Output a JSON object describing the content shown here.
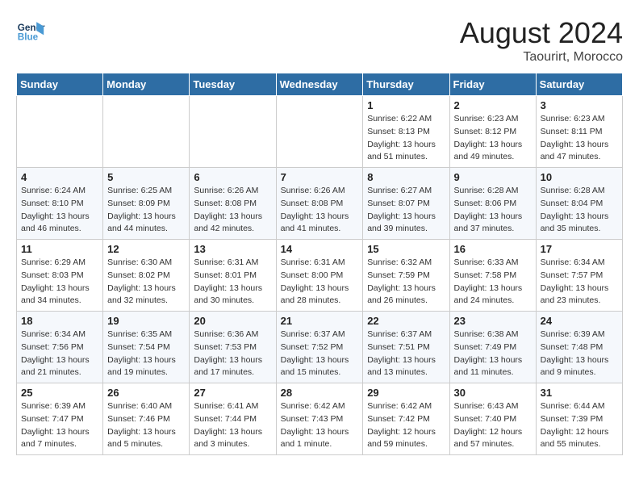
{
  "header": {
    "logo_line1": "General",
    "logo_line2": "Blue",
    "month_title": "August 2024",
    "location": "Taourirt, Morocco"
  },
  "weekdays": [
    "Sunday",
    "Monday",
    "Tuesday",
    "Wednesday",
    "Thursday",
    "Friday",
    "Saturday"
  ],
  "weeks": [
    [
      {
        "day": "",
        "info": ""
      },
      {
        "day": "",
        "info": ""
      },
      {
        "day": "",
        "info": ""
      },
      {
        "day": "",
        "info": ""
      },
      {
        "day": "1",
        "info": "Sunrise: 6:22 AM\nSunset: 8:13 PM\nDaylight: 13 hours\nand 51 minutes."
      },
      {
        "day": "2",
        "info": "Sunrise: 6:23 AM\nSunset: 8:12 PM\nDaylight: 13 hours\nand 49 minutes."
      },
      {
        "day": "3",
        "info": "Sunrise: 6:23 AM\nSunset: 8:11 PM\nDaylight: 13 hours\nand 47 minutes."
      }
    ],
    [
      {
        "day": "4",
        "info": "Sunrise: 6:24 AM\nSunset: 8:10 PM\nDaylight: 13 hours\nand 46 minutes."
      },
      {
        "day": "5",
        "info": "Sunrise: 6:25 AM\nSunset: 8:09 PM\nDaylight: 13 hours\nand 44 minutes."
      },
      {
        "day": "6",
        "info": "Sunrise: 6:26 AM\nSunset: 8:08 PM\nDaylight: 13 hours\nand 42 minutes."
      },
      {
        "day": "7",
        "info": "Sunrise: 6:26 AM\nSunset: 8:08 PM\nDaylight: 13 hours\nand 41 minutes."
      },
      {
        "day": "8",
        "info": "Sunrise: 6:27 AM\nSunset: 8:07 PM\nDaylight: 13 hours\nand 39 minutes."
      },
      {
        "day": "9",
        "info": "Sunrise: 6:28 AM\nSunset: 8:06 PM\nDaylight: 13 hours\nand 37 minutes."
      },
      {
        "day": "10",
        "info": "Sunrise: 6:28 AM\nSunset: 8:04 PM\nDaylight: 13 hours\nand 35 minutes."
      }
    ],
    [
      {
        "day": "11",
        "info": "Sunrise: 6:29 AM\nSunset: 8:03 PM\nDaylight: 13 hours\nand 34 minutes."
      },
      {
        "day": "12",
        "info": "Sunrise: 6:30 AM\nSunset: 8:02 PM\nDaylight: 13 hours\nand 32 minutes."
      },
      {
        "day": "13",
        "info": "Sunrise: 6:31 AM\nSunset: 8:01 PM\nDaylight: 13 hours\nand 30 minutes."
      },
      {
        "day": "14",
        "info": "Sunrise: 6:31 AM\nSunset: 8:00 PM\nDaylight: 13 hours\nand 28 minutes."
      },
      {
        "day": "15",
        "info": "Sunrise: 6:32 AM\nSunset: 7:59 PM\nDaylight: 13 hours\nand 26 minutes."
      },
      {
        "day": "16",
        "info": "Sunrise: 6:33 AM\nSunset: 7:58 PM\nDaylight: 13 hours\nand 24 minutes."
      },
      {
        "day": "17",
        "info": "Sunrise: 6:34 AM\nSunset: 7:57 PM\nDaylight: 13 hours\nand 23 minutes."
      }
    ],
    [
      {
        "day": "18",
        "info": "Sunrise: 6:34 AM\nSunset: 7:56 PM\nDaylight: 13 hours\nand 21 minutes."
      },
      {
        "day": "19",
        "info": "Sunrise: 6:35 AM\nSunset: 7:54 PM\nDaylight: 13 hours\nand 19 minutes."
      },
      {
        "day": "20",
        "info": "Sunrise: 6:36 AM\nSunset: 7:53 PM\nDaylight: 13 hours\nand 17 minutes."
      },
      {
        "day": "21",
        "info": "Sunrise: 6:37 AM\nSunset: 7:52 PM\nDaylight: 13 hours\nand 15 minutes."
      },
      {
        "day": "22",
        "info": "Sunrise: 6:37 AM\nSunset: 7:51 PM\nDaylight: 13 hours\nand 13 minutes."
      },
      {
        "day": "23",
        "info": "Sunrise: 6:38 AM\nSunset: 7:49 PM\nDaylight: 13 hours\nand 11 minutes."
      },
      {
        "day": "24",
        "info": "Sunrise: 6:39 AM\nSunset: 7:48 PM\nDaylight: 13 hours\nand 9 minutes."
      }
    ],
    [
      {
        "day": "25",
        "info": "Sunrise: 6:39 AM\nSunset: 7:47 PM\nDaylight: 13 hours\nand 7 minutes."
      },
      {
        "day": "26",
        "info": "Sunrise: 6:40 AM\nSunset: 7:46 PM\nDaylight: 13 hours\nand 5 minutes."
      },
      {
        "day": "27",
        "info": "Sunrise: 6:41 AM\nSunset: 7:44 PM\nDaylight: 13 hours\nand 3 minutes."
      },
      {
        "day": "28",
        "info": "Sunrise: 6:42 AM\nSunset: 7:43 PM\nDaylight: 13 hours\nand 1 minute."
      },
      {
        "day": "29",
        "info": "Sunrise: 6:42 AM\nSunset: 7:42 PM\nDaylight: 12 hours\nand 59 minutes."
      },
      {
        "day": "30",
        "info": "Sunrise: 6:43 AM\nSunset: 7:40 PM\nDaylight: 12 hours\nand 57 minutes."
      },
      {
        "day": "31",
        "info": "Sunrise: 6:44 AM\nSunset: 7:39 PM\nDaylight: 12 hours\nand 55 minutes."
      }
    ]
  ]
}
